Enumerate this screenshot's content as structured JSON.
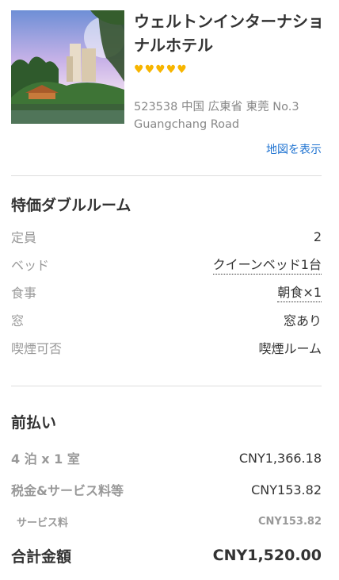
{
  "hotel": {
    "name": "ウェルトンインターナショナルホテル",
    "star_count": 5,
    "star_glyph": "♥",
    "address": "523538 中国 広東省 東莞 No.3 Guangchang Road",
    "map_link": "地図を表示"
  },
  "room": {
    "title": "特価ダブルルーム",
    "details": [
      {
        "label": "定員",
        "value": "2"
      },
      {
        "label": "ベッド",
        "value": "クイーンベッド1台"
      },
      {
        "label": "食事",
        "value": "朝食×1"
      },
      {
        "label": "窓",
        "value": "窓あり"
      },
      {
        "label": "喫煙可否",
        "value": "喫煙ルーム"
      }
    ]
  },
  "payment": {
    "title": "前払い",
    "nights_label": "4 泊 x 1 室",
    "nights_value": "CNY1,366.18",
    "tax_label": "税金&サービス料等",
    "tax_value": "CNY153.82",
    "service_label": "サービス料",
    "service_value": "CNY153.82",
    "total_label": "合計金額",
    "total_value": "CNY1,520.00"
  },
  "colors": {
    "accent_link": "#1f73d1",
    "star": "#f7b500"
  }
}
